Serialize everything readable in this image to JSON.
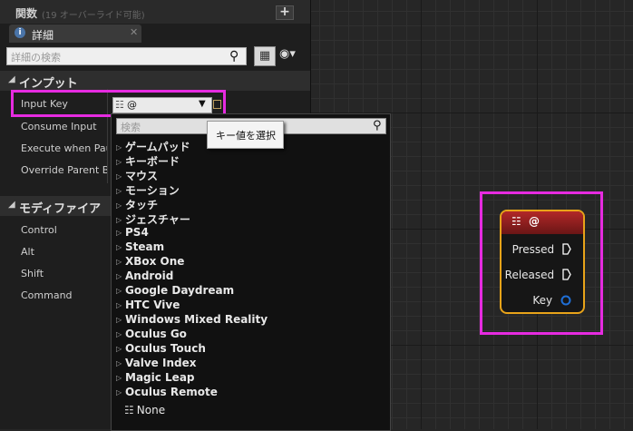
{
  "functions_row": {
    "title": "関数",
    "subtitle": "(19 オーバーライド可能)",
    "add_icon": "plus-icon"
  },
  "details_tab": {
    "label": "詳細",
    "icon": "info-icon",
    "close": "✕"
  },
  "details_search": {
    "placeholder": "詳細の検索"
  },
  "sections": {
    "input": {
      "label": "インプット",
      "props": [
        "Input Key",
        "Consume Input",
        "Execute when Paused",
        "Override Parent Binding"
      ]
    },
    "modifier": {
      "label": "モディファイア",
      "props": [
        "Control",
        "Alt",
        "Shift",
        "Command"
      ]
    }
  },
  "input_key": {
    "value": "@"
  },
  "tooltip": "キー値を選択",
  "dropdown": {
    "search_placeholder": "検索",
    "categories": [
      "ゲームパッド",
      "キーボード",
      "マウス",
      "モーション",
      "タッチ",
      "ジェスチャー",
      "PS4",
      "Steam",
      "XBox One",
      "Android",
      "Google Daydream",
      "HTC Vive",
      "Windows Mixed Reality",
      "Oculus Go",
      "Oculus Touch",
      "Valve Index",
      "Magic Leap",
      "Oculus Remote"
    ],
    "none_label": "None"
  },
  "node": {
    "title": "@",
    "pins": {
      "pressed": "Pressed",
      "released": "Released",
      "key": "Key"
    }
  },
  "colors": {
    "highlight": "#e62be0",
    "node_border": "#e8a319",
    "node_header": "#b22828"
  }
}
